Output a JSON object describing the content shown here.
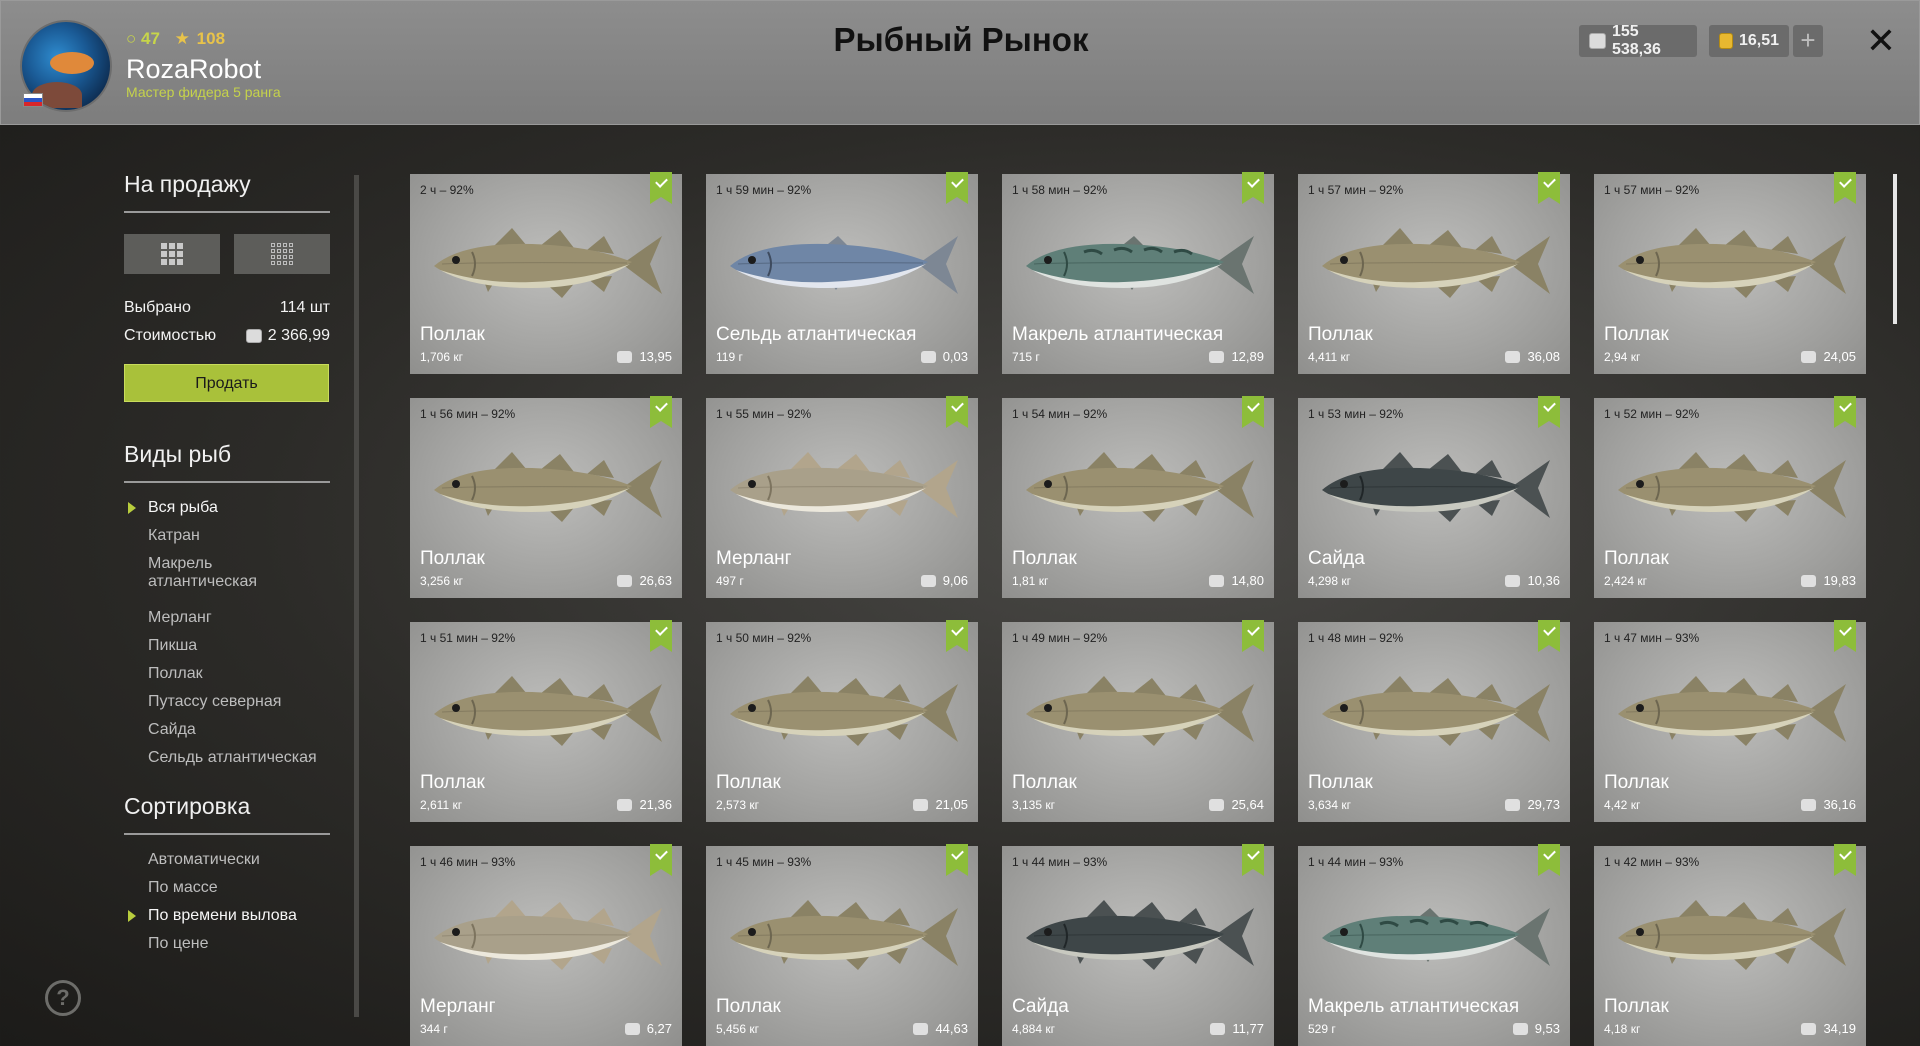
{
  "header": {
    "title": "Рыбный Рынок",
    "player": {
      "level": "47",
      "stars": "108",
      "name": "RozaRobot",
      "rank": "Мастер фидера 5 ранга"
    },
    "silver": "155 538,36",
    "gold": "16,51",
    "plus": "+",
    "close": "✕"
  },
  "sidebar": {
    "for_sale_title": "На продажу",
    "selected_label": "Выбрано",
    "selected_value": "114 шт",
    "cost_label": "Стоимостью",
    "cost_value": "2 366,99",
    "sell_button": "Продать",
    "species_title": "Виды рыб",
    "species": [
      {
        "label": "Вся рыба",
        "active": true
      },
      {
        "label": "Катран"
      },
      {
        "label": "Макрель атлантическая"
      },
      {
        "label": "Мерланг"
      },
      {
        "label": "Пикша"
      },
      {
        "label": "Поллак"
      },
      {
        "label": "Путассу северная"
      },
      {
        "label": "Сайда"
      },
      {
        "label": "Сельдь атлантическая"
      }
    ],
    "sort_title": "Сортировка",
    "sort": [
      {
        "label": "Автоматически"
      },
      {
        "label": "По массе"
      },
      {
        "label": "По времени вылова",
        "active": true
      },
      {
        "label": "По цене"
      }
    ],
    "help": "?"
  },
  "cards": [
    {
      "time": "2 ч – 92%",
      "name": "Поллак",
      "weight": "1,706 кг",
      "price": "13,95",
      "kind": "pollack"
    },
    {
      "time": "1 ч 59 мин – 92%",
      "name": "Сельдь атлантическая",
      "weight": "119 г",
      "price": "0,03",
      "kind": "herring"
    },
    {
      "time": "1 ч 58 мин – 92%",
      "name": "Макрель атлантическая",
      "weight": "715 г",
      "price": "12,89",
      "kind": "mackerel"
    },
    {
      "time": "1 ч 57 мин – 92%",
      "name": "Поллак",
      "weight": "4,411 кг",
      "price": "36,08",
      "kind": "pollack"
    },
    {
      "time": "1 ч 57 мин – 92%",
      "name": "Поллак",
      "weight": "2,94 кг",
      "price": "24,05",
      "kind": "pollack"
    },
    {
      "time": "1 ч 56 мин – 92%",
      "name": "Поллак",
      "weight": "3,256 кг",
      "price": "26,63",
      "kind": "pollack"
    },
    {
      "time": "1 ч 55 мин – 92%",
      "name": "Мерланг",
      "weight": "497 г",
      "price": "9,06",
      "kind": "whiting"
    },
    {
      "time": "1 ч 54 мин – 92%",
      "name": "Поллак",
      "weight": "1,81 кг",
      "price": "14,80",
      "kind": "pollack"
    },
    {
      "time": "1 ч 53 мин – 92%",
      "name": "Сайда",
      "weight": "4,298 кг",
      "price": "10,36",
      "kind": "saithe"
    },
    {
      "time": "1 ч 52 мин – 92%",
      "name": "Поллак",
      "weight": "2,424 кг",
      "price": "19,83",
      "kind": "pollack"
    },
    {
      "time": "1 ч 51 мин – 92%",
      "name": "Поллак",
      "weight": "2,611 кг",
      "price": "21,36",
      "kind": "pollack"
    },
    {
      "time": "1 ч 50 мин – 92%",
      "name": "Поллак",
      "weight": "2,573 кг",
      "price": "21,05",
      "kind": "pollack"
    },
    {
      "time": "1 ч 49 мин – 92%",
      "name": "Поллак",
      "weight": "3,135 кг",
      "price": "25,64",
      "kind": "pollack"
    },
    {
      "time": "1 ч 48 мин – 92%",
      "name": "Поллак",
      "weight": "3,634 кг",
      "price": "29,73",
      "kind": "pollack"
    },
    {
      "time": "1 ч 47 мин – 93%",
      "name": "Поллак",
      "weight": "4,42 кг",
      "price": "36,16",
      "kind": "pollack"
    },
    {
      "time": "1 ч 46 мин – 93%",
      "name": "Мерланг",
      "weight": "344 г",
      "price": "6,27",
      "kind": "whiting"
    },
    {
      "time": "1 ч 45 мин – 93%",
      "name": "Поллак",
      "weight": "5,456 кг",
      "price": "44,63",
      "kind": "pollack"
    },
    {
      "time": "1 ч 44 мин – 93%",
      "name": "Сайда",
      "weight": "4,884 кг",
      "price": "11,77",
      "kind": "saithe"
    },
    {
      "time": "1 ч 44 мин – 93%",
      "name": "Макрель атлантическая",
      "weight": "529 г",
      "price": "9,53",
      "kind": "mackerel"
    },
    {
      "time": "1 ч 42 мин – 93%",
      "name": "Поллак",
      "weight": "4,18 кг",
      "price": "34,19",
      "kind": "pollack"
    }
  ]
}
